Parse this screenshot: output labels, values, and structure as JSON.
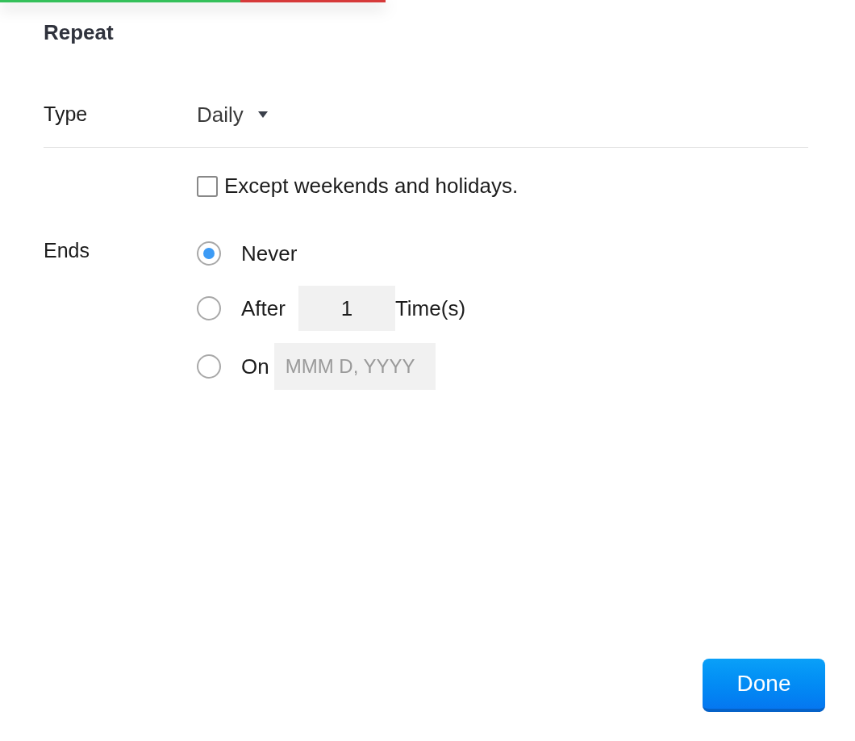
{
  "title": "Repeat",
  "type": {
    "label": "Type",
    "value": "Daily"
  },
  "skip_weekends": {
    "label": "Except weekends and holidays.",
    "checked": false
  },
  "ends": {
    "label": "Ends",
    "options": [
      {
        "kind": "plain",
        "label": "Never",
        "selected": true
      },
      {
        "kind": "count",
        "label": "After",
        "value": "1",
        "suffix": "Time(s)",
        "selected": false
      },
      {
        "kind": "date",
        "label": "On",
        "placeholder": "MMM D, YYYY",
        "selected": false
      }
    ]
  },
  "done_button": "Done"
}
